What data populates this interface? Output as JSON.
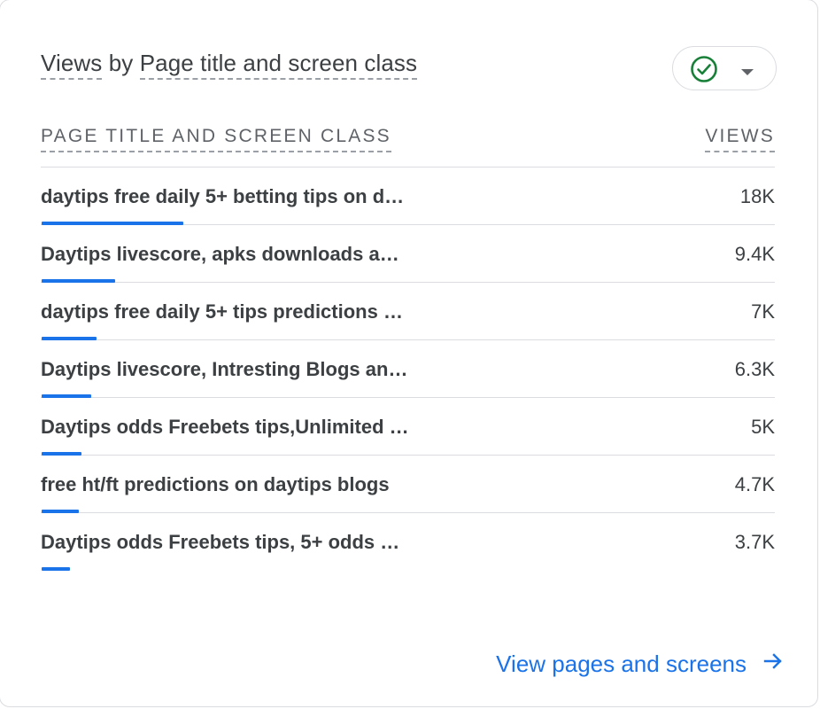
{
  "card": {
    "title_prefix": "Views",
    "title_by": " by ",
    "title_dimension": "Page title and screen class",
    "status_icon": "check-circle-icon",
    "dropdown_icon": "caret-down-icon"
  },
  "table": {
    "col_dimension": "PAGE TITLE AND SCREEN CLASS",
    "col_metric": "VIEWS",
    "rows": [
      {
        "title": "daytips free daily 5+ betting tips on d…",
        "views": "18K",
        "share": 1.0
      },
      {
        "title": "Daytips livescore, apks downloads a…",
        "views": "9.4K",
        "share": 0.52
      },
      {
        "title": "daytips free daily 5+ tips predictions …",
        "views": "7K",
        "share": 0.39
      },
      {
        "title": "Daytips livescore, Intresting Blogs an…",
        "views": "6.3K",
        "share": 0.35
      },
      {
        "title": "Daytips odds Freebets tips,Unlimited …",
        "views": "5K",
        "share": 0.28
      },
      {
        "title": "free ht/ft predictions on daytips blogs",
        "views": "4.7K",
        "share": 0.26
      },
      {
        "title": "Daytips odds Freebets tips, 5+ odds …",
        "views": "3.7K",
        "share": 0.2
      }
    ]
  },
  "footer": {
    "link_label": "View pages and screens",
    "link_icon": "arrow-right-icon"
  },
  "colors": {
    "accent": "#1a73e8",
    "status_green": "#188038"
  }
}
